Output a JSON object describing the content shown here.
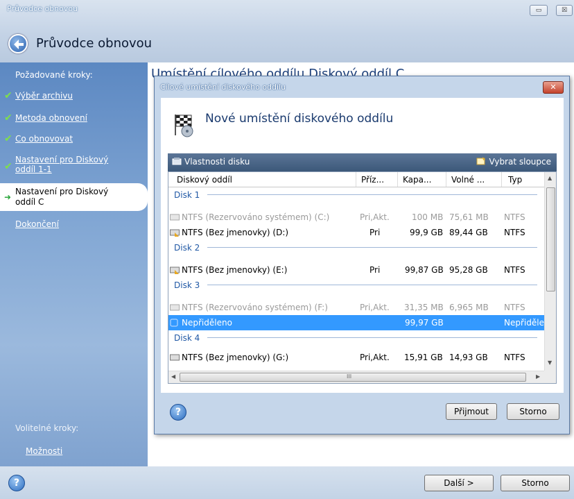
{
  "window": {
    "title": "Průvodce obnovou",
    "heading": "Průvodce obnovou",
    "btn_restore": "▭",
    "btn_close": "☒"
  },
  "sidebar": {
    "heading": "Požadované kroky:",
    "items": [
      {
        "label": "Výběr archivu"
      },
      {
        "label": "Metoda obnovení"
      },
      {
        "label": "Co obnovovat"
      },
      {
        "label_line1": "Nastavení pro Diskový",
        "label_line2": "oddíl 1-1"
      },
      {
        "label_line1": "Nastavení pro Diskový",
        "label_line2": "oddíl C"
      },
      {
        "label": "Dokončení"
      }
    ],
    "optional_heading": "Volitelné kroky:",
    "options_link": "Možnosti"
  },
  "main": {
    "heading": "Umístění cílového oddílu Diskový oddíl C"
  },
  "dialog": {
    "title": "Cílové umístění diskového oddílu",
    "close": "✕",
    "heading": "Nové umístění diskového oddílu",
    "toolbar": {
      "disk_properties": "Vlastnosti disku",
      "select_columns": "Vybrat sloupce"
    },
    "columns": [
      "Diskový oddíl",
      "Příz...",
      "Kapa...",
      "Volné ...",
      "Typ"
    ],
    "rows": [
      {
        "kind": "group",
        "label": "Disk 1"
      },
      {
        "kind": "part",
        "dim": true,
        "name": "NTFS (Rezervováno systémem) (C:)",
        "flags": "Pri,Akt.",
        "cap": "100 MB",
        "free": "75,61 MB",
        "type": "NTFS"
      },
      {
        "kind": "part",
        "dim": false,
        "name": "NTFS (Bez jmenovky) (D:)",
        "flags": "Pri",
        "cap": "99,9 GB",
        "free": "89,44 GB",
        "type": "NTFS"
      },
      {
        "kind": "group",
        "label": "Disk 2"
      },
      {
        "kind": "part",
        "dim": false,
        "name": "NTFS (Bez jmenovky) (E:)",
        "flags": "Pri",
        "cap": "99,87 GB",
        "free": "95,28 GB",
        "type": "NTFS"
      },
      {
        "kind": "group",
        "label": "Disk 3"
      },
      {
        "kind": "part",
        "dim": true,
        "name": "NTFS (Rezervováno systémem) (F:)",
        "flags": "Pri,Akt.",
        "cap": "31,35 MB",
        "free": "6,965 MB",
        "type": "NTFS"
      },
      {
        "kind": "part",
        "dim": false,
        "selected": true,
        "name": "Nepřiděleno",
        "flags": "",
        "cap": "99,97 GB",
        "free": "",
        "type": "Nepřiděle"
      },
      {
        "kind": "group",
        "label": "Disk 4"
      },
      {
        "kind": "part",
        "dim": false,
        "name": "NTFS (Bez jmenovky) (G:)",
        "flags": "Pri,Akt.",
        "cap": "15,91 GB",
        "free": "14,93 GB",
        "type": "NTFS"
      }
    ],
    "hscroll_mark": "III",
    "accept": "Přijmout",
    "cancel": "Storno",
    "help": "?"
  },
  "bottom": {
    "help": "?",
    "next": "Další >",
    "cancel": "Storno"
  }
}
